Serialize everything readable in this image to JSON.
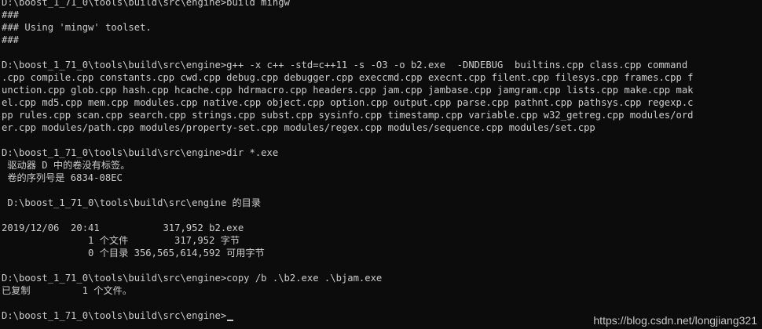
{
  "terminal": {
    "lines": [
      "D:\\boost_1_71_0\\tools\\build\\src\\engine>build mingw",
      "###",
      "### Using 'mingw' toolset.",
      "###",
      "",
      "D:\\boost_1_71_0\\tools\\build\\src\\engine>g++ -x c++ -std=c++11 -s -O3 -o b2.exe  -DNDEBUG  builtins.cpp class.cpp command",
      ".cpp compile.cpp constants.cpp cwd.cpp debug.cpp debugger.cpp execcmd.cpp execnt.cpp filent.cpp filesys.cpp frames.cpp f",
      "unction.cpp glob.cpp hash.cpp hcache.cpp hdrmacro.cpp headers.cpp jam.cpp jambase.cpp jamgram.cpp lists.cpp make.cpp mak",
      "el.cpp md5.cpp mem.cpp modules.cpp native.cpp object.cpp option.cpp output.cpp parse.cpp pathnt.cpp pathsys.cpp regexp.c",
      "pp rules.cpp scan.cpp search.cpp strings.cpp subst.cpp sysinfo.cpp timestamp.cpp variable.cpp w32_getreg.cpp modules/ord",
      "er.cpp modules/path.cpp modules/property-set.cpp modules/regex.cpp modules/sequence.cpp modules/set.cpp",
      "",
      "D:\\boost_1_71_0\\tools\\build\\src\\engine>dir *.exe",
      " 驱动器 D 中的卷没有标签。",
      " 卷的序列号是 6834-08EC",
      "",
      " D:\\boost_1_71_0\\tools\\build\\src\\engine 的目录",
      "",
      "2019/12/06  20:41           317,952 b2.exe",
      "               1 个文件        317,952 字节",
      "               0 个目录 356,565,614,592 可用字节",
      "",
      "D:\\boost_1_71_0\\tools\\build\\src\\engine>copy /b .\\b2.exe .\\bjam.exe",
      "已复制         1 个文件。",
      "",
      "D:\\boost_1_71_0\\tools\\build\\src\\engine>"
    ]
  },
  "watermark": "https://blog.csdn.net/longjiang321",
  "colors": {
    "background": "#0c0c0c",
    "text": "#cccccc"
  }
}
